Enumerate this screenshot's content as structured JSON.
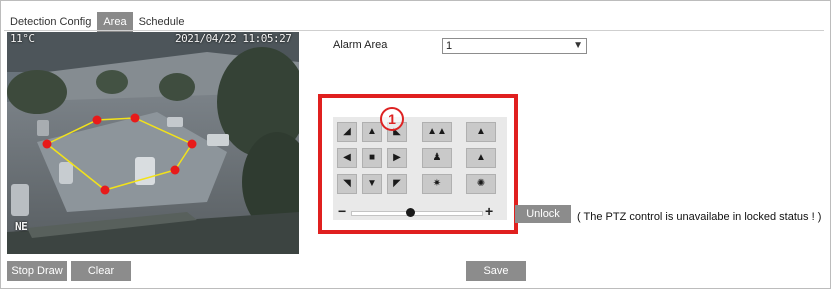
{
  "tabs": [
    {
      "label": "Detection Config"
    },
    {
      "label": "Area"
    },
    {
      "label": "Schedule"
    }
  ],
  "video": {
    "temperature": "11°C",
    "timestamp": "2021/04/22 11:05:27",
    "compass": "NE"
  },
  "buttons": {
    "stop_draw": "Stop Draw",
    "clear": "Clear",
    "save": "Save",
    "unlock": "Unlock"
  },
  "alarm_area": {
    "label": "Alarm Area",
    "value": "1"
  },
  "ptz": {
    "marker": "1",
    "zoom_minus": "−",
    "zoom_plus": "+",
    "speed_level": 0.45,
    "note": "( The PTZ control is unavailabe in locked status ! )",
    "icons": [
      "up-left-arrow-icon",
      "up-arrow-icon",
      "up-right-arrow-icon",
      "left-arrow-icon",
      "stop-icon",
      "right-arrow-icon",
      "down-left-arrow-icon",
      "down-arrow-icon",
      "down-right-arrow-icon",
      "wide-scene-icon",
      "tree-icon",
      "person-icon",
      "mountain-icon",
      "focus-near-icon",
      "focus-far-icon"
    ]
  },
  "colors": {
    "highlight_box": "#e0201f",
    "polygon_line": "#f2e21a",
    "polygon_vertex": "#e81a1a",
    "button_bg": "#8c8c8c"
  }
}
